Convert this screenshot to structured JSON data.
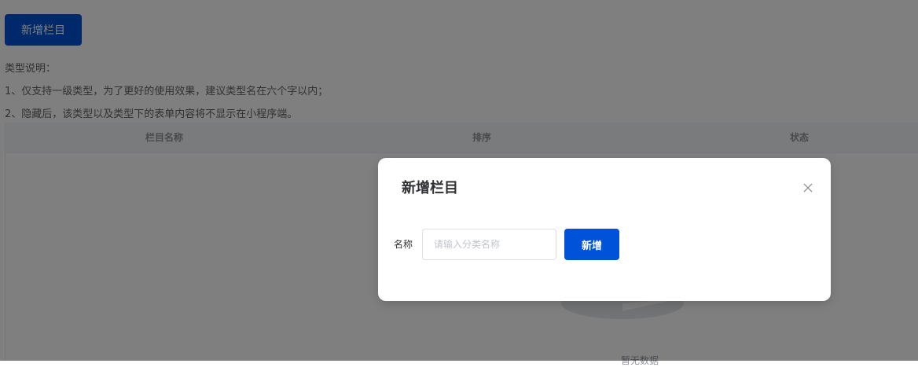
{
  "toolbar": {
    "add_label": "新增栏目"
  },
  "notes": {
    "title": "类型说明：",
    "line1": "1、仅支持一级类型，为了更好的使用效果，建议类型名在六个字以内；",
    "line2": "2、隐藏后，该类型以及类型下的表单内容将不显示在小程序端。"
  },
  "table": {
    "columns": [
      "栏目名称",
      "排序",
      "状态"
    ],
    "empty_text": "暂无数据"
  },
  "dialog": {
    "title": "新增栏目",
    "name_label": "名称",
    "name_value": "",
    "name_placeholder": "请输入分类名称",
    "submit_label": "新增",
    "close_icon": "close-icon"
  },
  "colors": {
    "primary": "#0052d9",
    "overlay": "rgba(0,0,0,0.5)"
  }
}
